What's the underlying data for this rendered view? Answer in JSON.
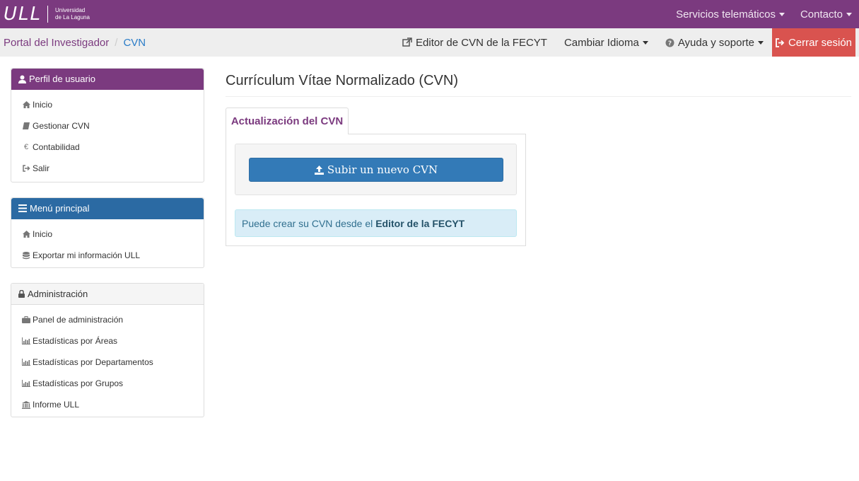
{
  "brand": {
    "logo_mark": "ULL",
    "name_line1": "Universidad",
    "name_line2": "de La Laguna"
  },
  "topnav": {
    "services_label": "Servicios telemáticos",
    "contact_label": "Contacto"
  },
  "breadcrumb": {
    "home_label": "Portal del Investigador",
    "separator": "/",
    "current_label": "CVN"
  },
  "subnav": {
    "fecyt_editor_label": "Editor de CVN de la FECYT",
    "language_label": "Cambiar Idioma",
    "help_label": "Ayuda y soporte",
    "logout_label": "Cerrar sesión"
  },
  "sidebar": {
    "profile": {
      "title": "Perfil de usuario",
      "items": [
        {
          "label": "Inicio",
          "icon": "home-icon"
        },
        {
          "label": "Gestionar CVN",
          "icon": "book-icon"
        },
        {
          "label": "Contabilidad",
          "icon": "euro-icon"
        },
        {
          "label": "Salir",
          "icon": "sign-out-icon"
        }
      ]
    },
    "main_menu": {
      "title": "Menú principal",
      "items": [
        {
          "label": "Inicio",
          "icon": "home-icon"
        },
        {
          "label": "Exportar mi información ULL",
          "icon": "database-icon"
        }
      ]
    },
    "admin": {
      "title": "Administración",
      "items": [
        {
          "label": "Panel de administración",
          "icon": "briefcase-icon"
        },
        {
          "label": "Estadísticas por Áreas",
          "icon": "bar-chart-icon"
        },
        {
          "label": "Estadísticas por Departamentos",
          "icon": "bar-chart-icon"
        },
        {
          "label": "Estadísticas por Grupos",
          "icon": "bar-chart-icon"
        },
        {
          "label": "Informe ULL",
          "icon": "institution-icon"
        }
      ]
    }
  },
  "main": {
    "title": "Currículum Vítae Normalizado (CVN)",
    "tab_label": "Actualización del CVN",
    "upload_label": "Subir un nuevo CVN",
    "info_text": "Puede crear su CVN desde el",
    "info_link": "Editor de la FECYT"
  },
  "colors": {
    "brand_purple": "#7b3a7f",
    "primary_blue": "#337ab7",
    "danger_red": "#d9534f",
    "info_bg": "#d9edf7"
  }
}
